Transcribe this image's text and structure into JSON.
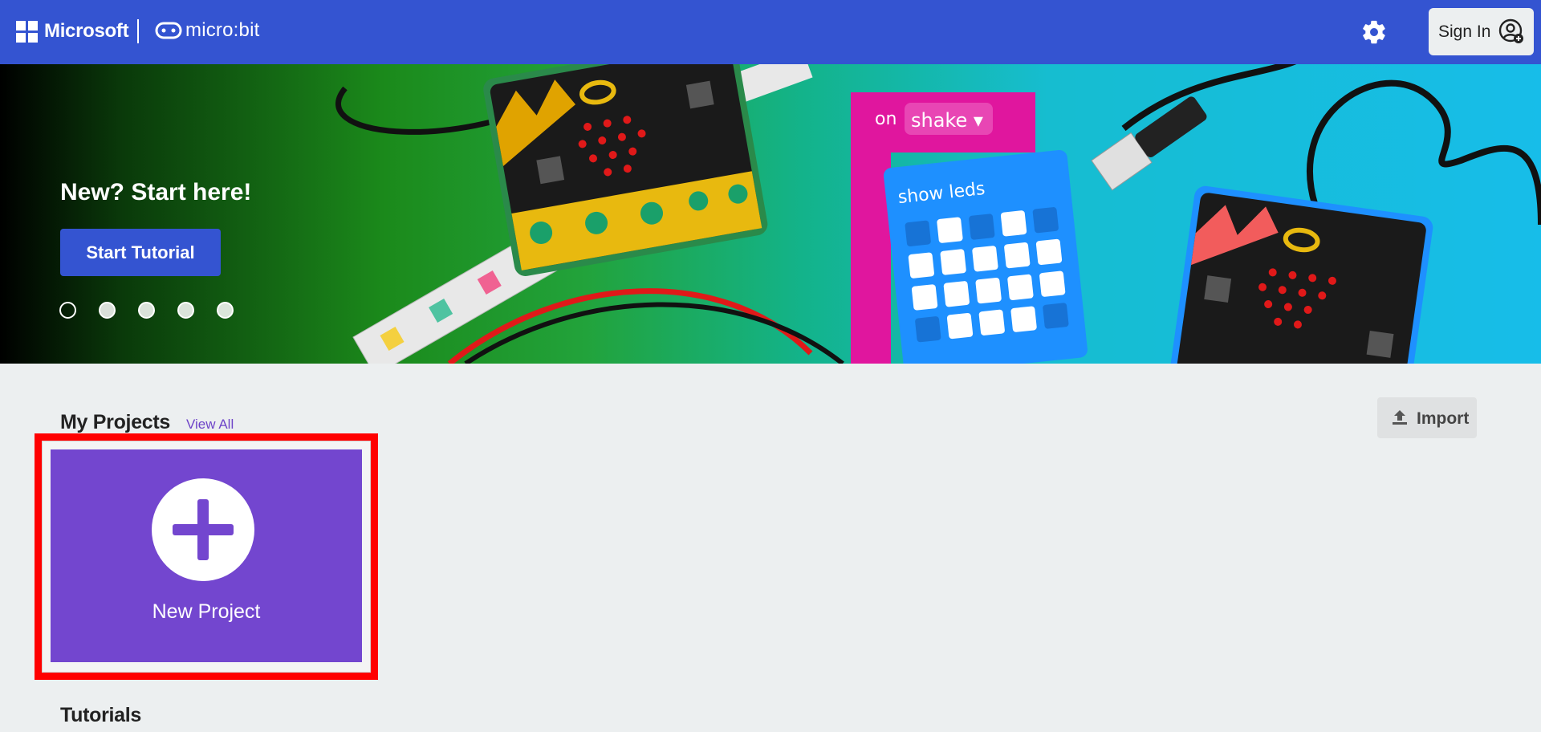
{
  "header": {
    "brand": "Microsoft",
    "product": "micro:bit",
    "settings_icon": "gear-icon",
    "sign_in_label": "Sign In",
    "sign_in_icon": "user-plus-icon",
    "color": "#3454d1"
  },
  "hero": {
    "title": "New? Start here!",
    "button_label": "Start Tutorial",
    "block_event": "on",
    "block_event_value": "shake",
    "block_action": "show leds",
    "carousel_dots": 5,
    "active_dot": 1
  },
  "projects": {
    "title": "My Projects",
    "view_all": "View All",
    "import_label": "Import",
    "import_icon": "upload-icon",
    "new_project_label": "New Project",
    "new_project_icon": "plus-icon",
    "card_color": "#7346cf"
  },
  "tutorials": {
    "title": "Tutorials"
  }
}
